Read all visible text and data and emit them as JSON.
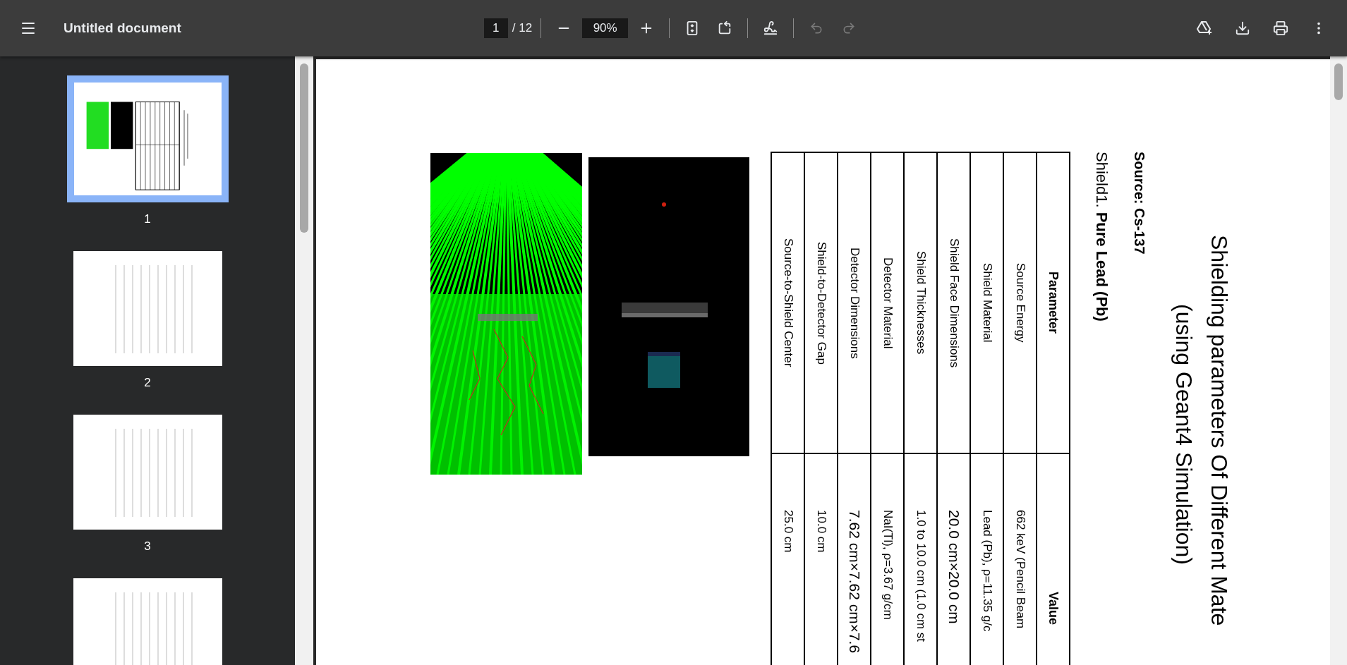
{
  "toolbar": {
    "title": "Untitled document",
    "page_input": "1",
    "page_count": "/ 12",
    "zoom": "90%",
    "undo": {
      "disabled": true
    },
    "redo": {
      "disabled": true
    }
  },
  "sidebar": {
    "thumbnails": [
      {
        "label": "1",
        "selected": true
      },
      {
        "label": "2",
        "selected": false
      },
      {
        "label": "3",
        "selected": false
      },
      {
        "selected": false
      }
    ]
  },
  "document": {
    "title_lines": [
      "Shielding parameters Of Different Mate",
      "(using Geant4 Simulation)"
    ],
    "source": "Source: Cs-137",
    "shield": "Shield1. **Pure Lead (Pb)**",
    "table": {
      "columns": [
        "Parameter",
        "Value"
      ],
      "rows": [
        {
          "parameter": "Source Energy",
          "value": "662 keV (Pencil Beam",
          "large": false
        },
        {
          "parameter": "Shield Material",
          "value": "Lead (Pb),  ρ=11.35 g/c",
          "large": false
        },
        {
          "parameter": "Shield Face Dimensions",
          "value": "20.0 cm×20.0 cm",
          "large": true
        },
        {
          "parameter": "Shield Thicknesses",
          "value": "1.0 to 10.0 cm (1.0 cm st",
          "large": false
        },
        {
          "parameter": "Detector Material",
          "value": "NaI(Tl),  ρ=3.67 g/cm",
          "large": false
        },
        {
          "parameter": "Detector Dimensions",
          "value": "7.62 cm×7.62 cm×7.6",
          "large": true
        },
        {
          "parameter": "Shield-to-Detector Gap",
          "value": "10.0 cm",
          "large": false
        },
        {
          "parameter": "Source-to-Shield Center",
          "value": "25.0 cm",
          "large": false
        }
      ]
    }
  }
}
